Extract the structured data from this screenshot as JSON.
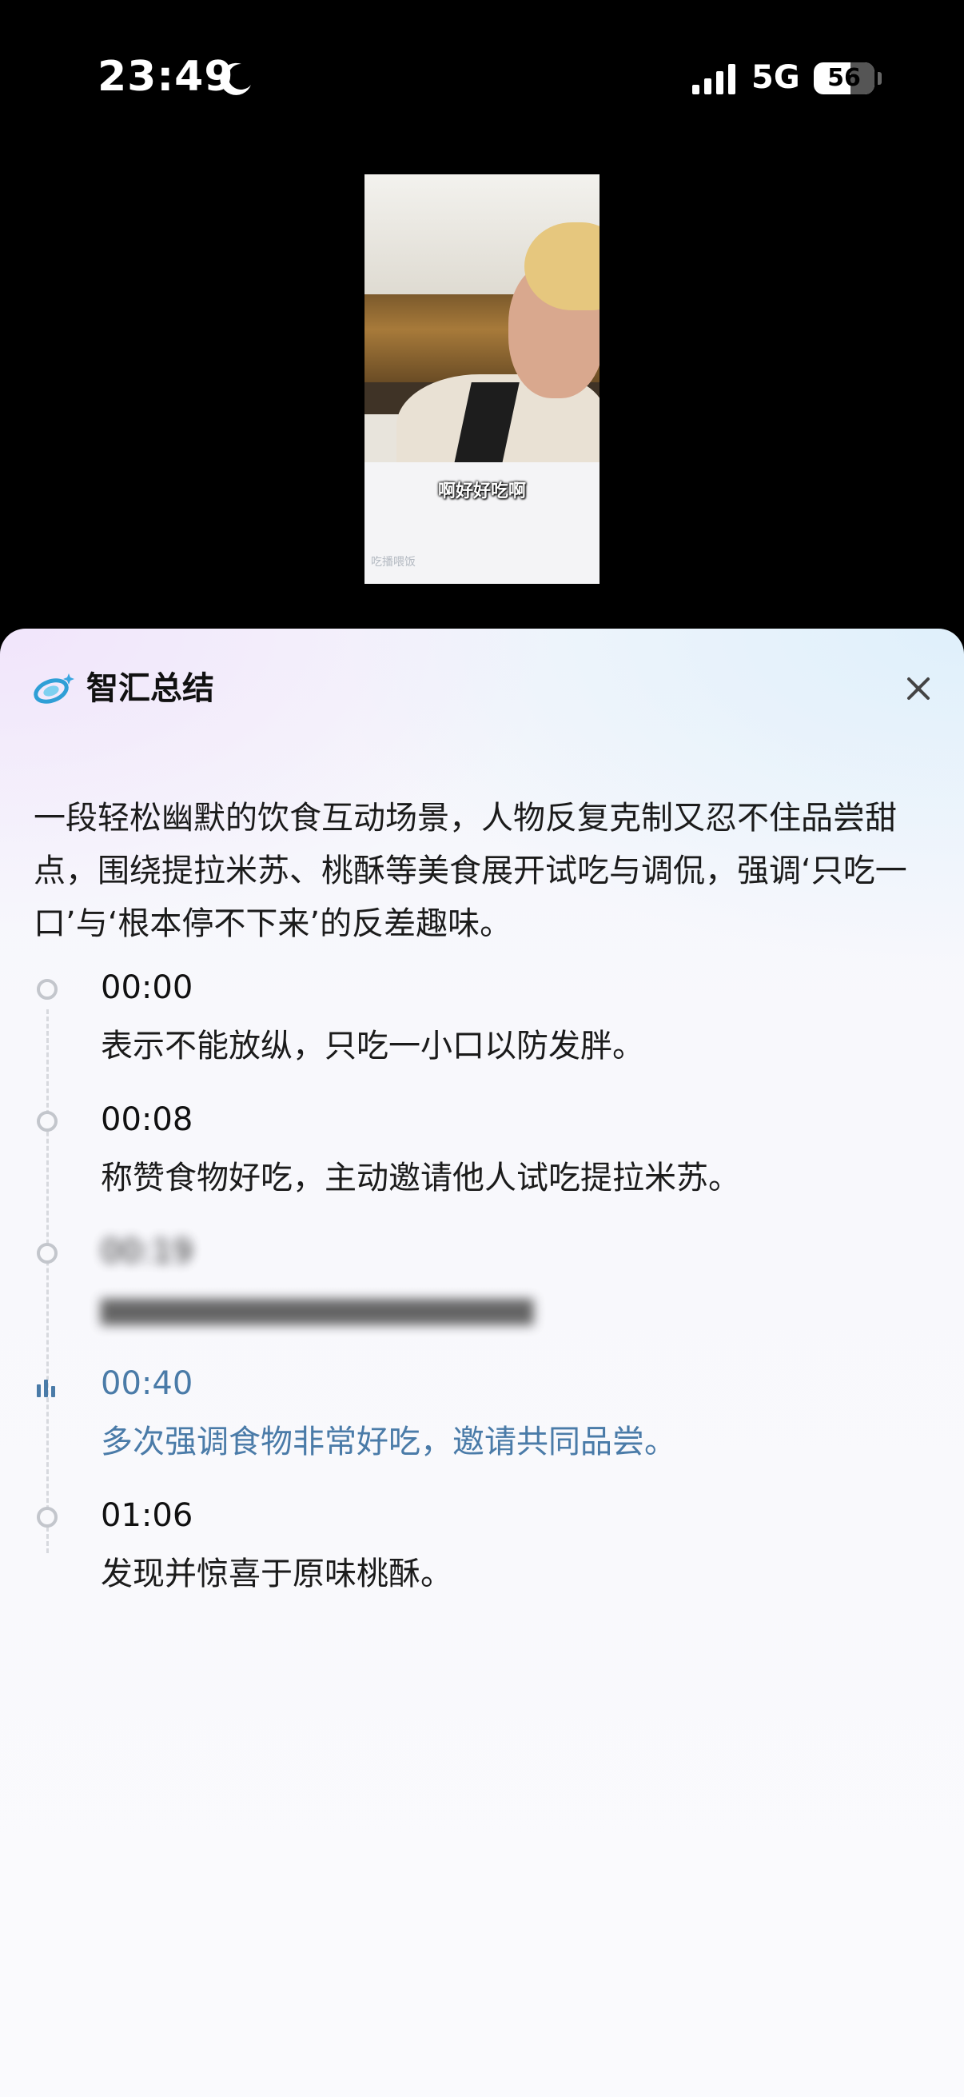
{
  "status_bar": {
    "time": "23:49",
    "network": "5G",
    "battery": "56"
  },
  "video": {
    "subtitle": "啊好好吃啊",
    "watermark": "吃播喂饭"
  },
  "sheet": {
    "title": "智汇总结",
    "summary": "一段轻松幽默的饮食互动场景，人物反复克制又忍不住品尝甜点，围绕提拉米苏、桃酥等美食展开试吃与调侃，强调‘只吃一口’与‘根本停不下来’的反差趣味。",
    "timeline": [
      {
        "time": "00:00",
        "text": "表示不能放纵，只吃一小口以防发胖。"
      },
      {
        "time": "00:08",
        "text": "称赞食物好吃，主动邀请他人试吃提拉米苏。"
      },
      {
        "time": "00:19",
        "text": "▇▇▇▇▇▇▇▇▇▇▇▇▇▇▇▇▇▇▇▇▇▇"
      },
      {
        "time": "00:40",
        "text": "多次强调食物非常好吃，邀请共同品尝。"
      },
      {
        "time": "01:06",
        "text": "发现并惊喜于原味桃酥。"
      }
    ]
  },
  "colors": {
    "accent": "#4a7ba8",
    "sheet_bg": "#f8f8fc"
  }
}
